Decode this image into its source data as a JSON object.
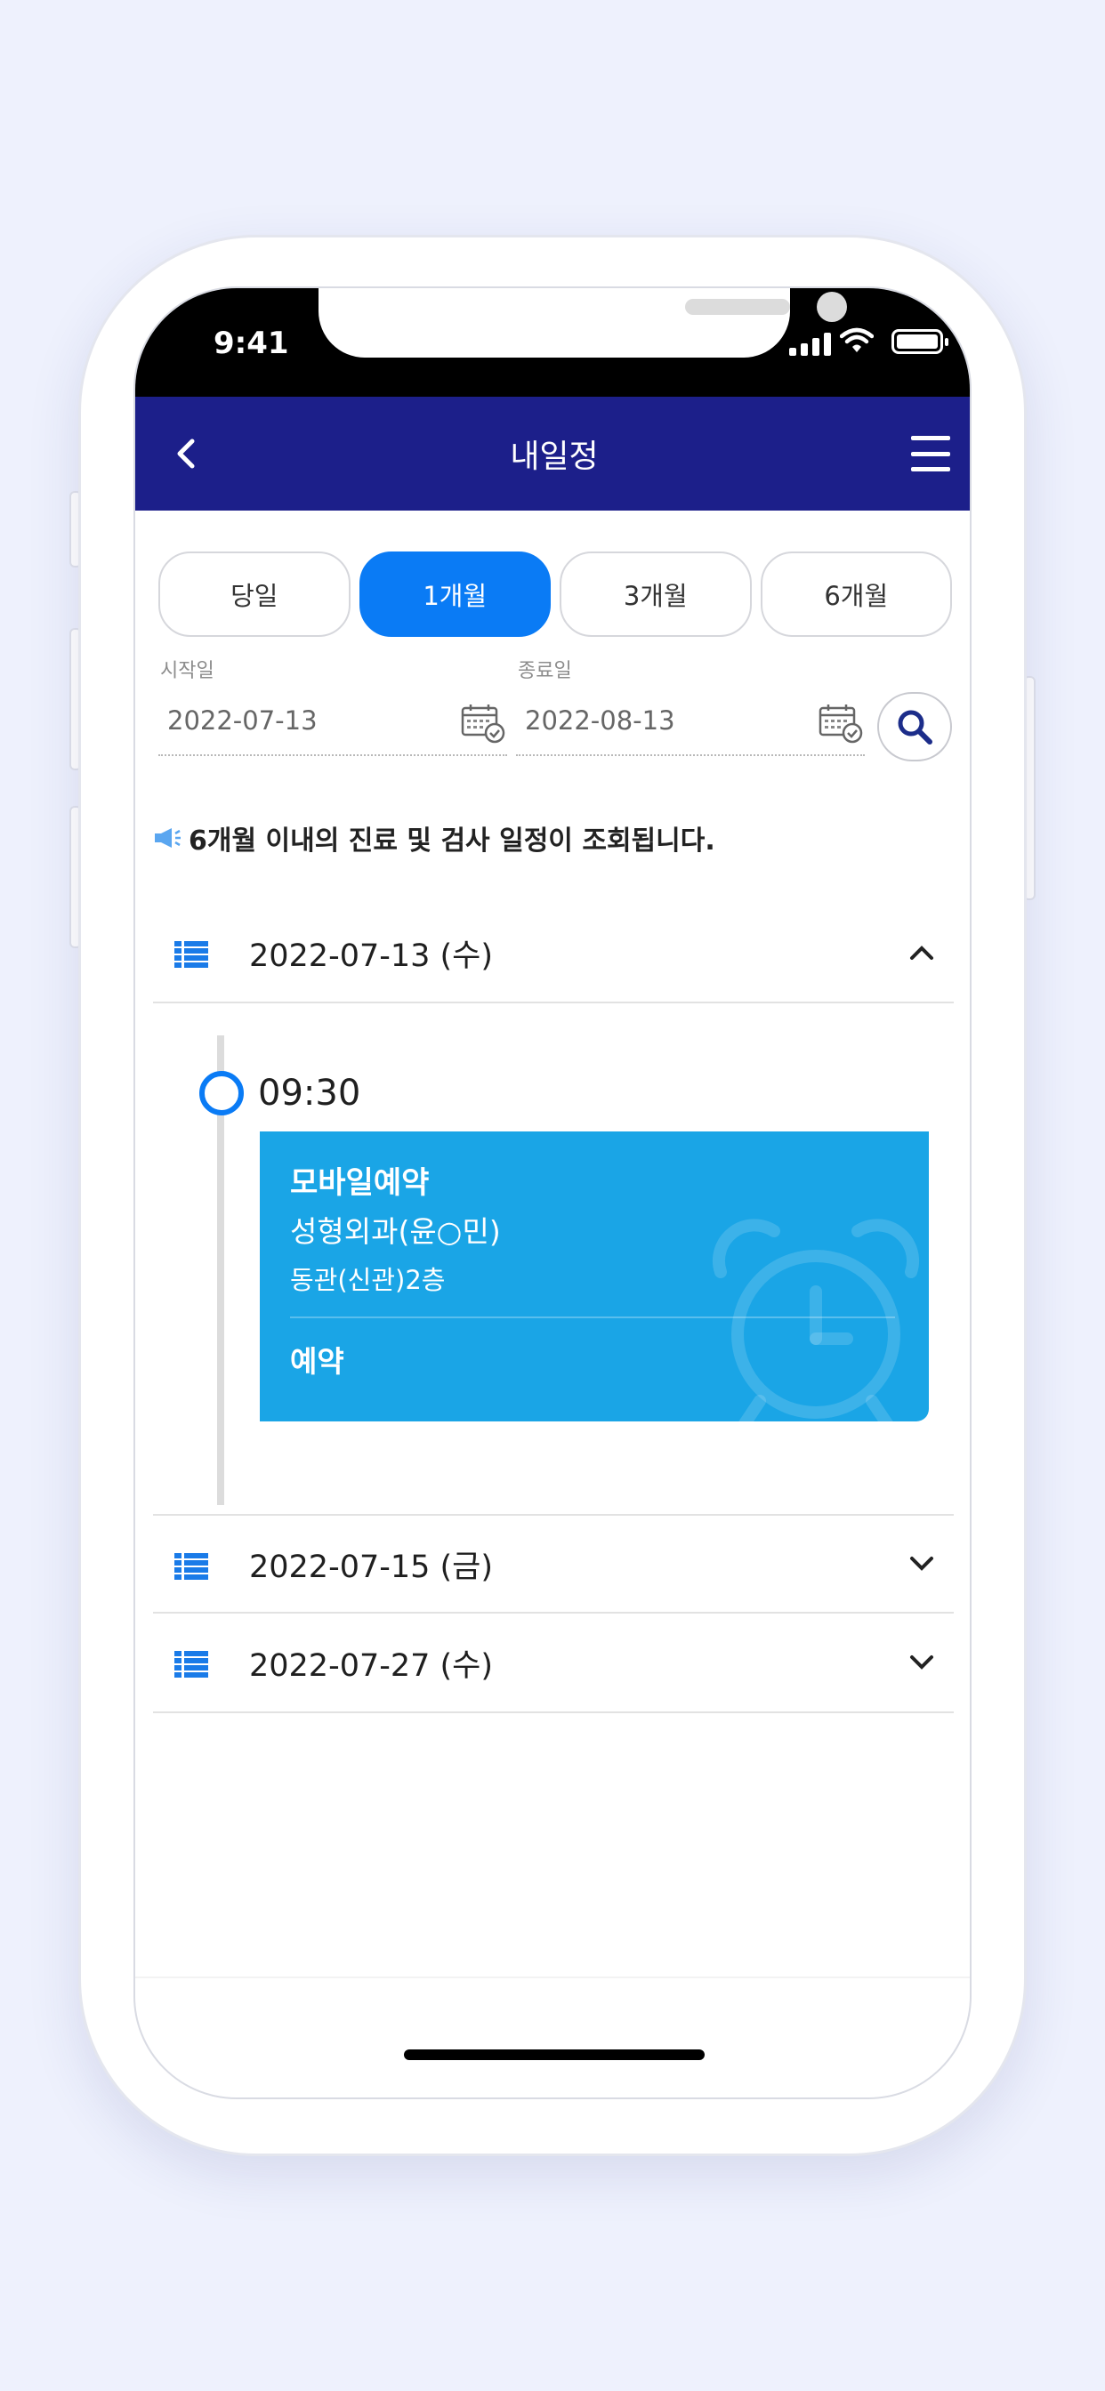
{
  "status": {
    "time": "9:41"
  },
  "header": {
    "title": "내일정"
  },
  "tabs": [
    {
      "label": "당일",
      "active": false
    },
    {
      "label": "1개월",
      "active": true
    },
    {
      "label": "3개월",
      "active": false
    },
    {
      "label": "6개월",
      "active": false
    }
  ],
  "range": {
    "start_label": "시작일",
    "start_value": "2022-07-13",
    "end_label": "종료일",
    "end_value": "2022-08-13"
  },
  "notice": "6개월 이내의 진료 및 검사 일정이 조회됩니다.",
  "days": [
    {
      "date": "2022-07-13 (수)",
      "expanded": true
    },
    {
      "date": "2022-07-15 (금)",
      "expanded": false
    },
    {
      "date": "2022-07-27 (수)",
      "expanded": false
    }
  ],
  "appointment": {
    "time": "09:30",
    "type": "모바일예약",
    "department": "성형외과(윤○민)",
    "location": "동관(신관)2층",
    "status": "예약"
  },
  "colors": {
    "header_bg": "#1c1f8a",
    "accent": "#0a7bf5",
    "card_bg": "#1aa5e6"
  }
}
